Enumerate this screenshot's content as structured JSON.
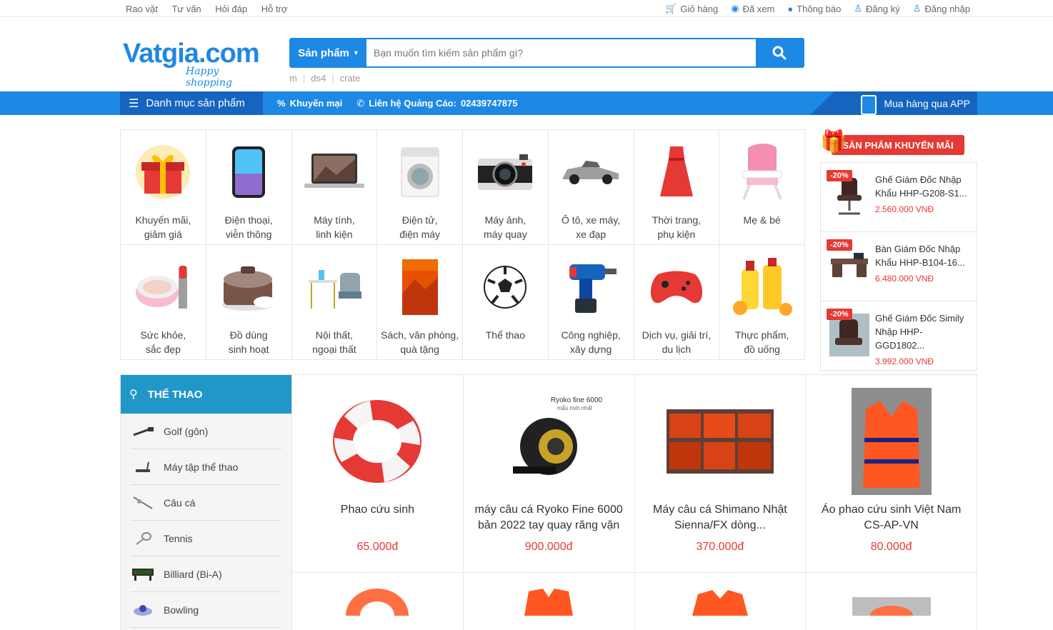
{
  "topbar": {
    "left": [
      "Rao vặt",
      "Tư vấn",
      "Hỏi đáp",
      "Hỗ trợ"
    ],
    "cart": "Giỏ hàng",
    "viewed": "Đã xem",
    "notify": "Thông báo",
    "register": "Đăng ký",
    "login": "Đăng nhập"
  },
  "logo": {
    "main": "Vatgia.com",
    "sub": "Happy shopping"
  },
  "search": {
    "category": "Sản phẩm",
    "placeholder": "Bạn muốn tìm kiếm sản phẩm gì?"
  },
  "keywords": [
    "m",
    "ds4",
    "crate"
  ],
  "nav": {
    "categories": "Danh mục sản phẩm",
    "promo": "Khuyến mại",
    "ads_label": "Liên hệ Quảng Cáo:",
    "ads_phone": "02439747875",
    "app": "Mua hàng qua APP"
  },
  "categories": [
    {
      "l1": "Khuyến mãi,",
      "l2": "giảm giá",
      "icon": "gift-icon"
    },
    {
      "l1": "Điện thoại,",
      "l2": "viễn thông",
      "icon": "phone-icon"
    },
    {
      "l1": "Máy tính,",
      "l2": "linh kiện",
      "icon": "laptop-icon"
    },
    {
      "l1": "Điện tử,",
      "l2": "điện máy",
      "icon": "washer-icon"
    },
    {
      "l1": "Máy ảnh,",
      "l2": "máy quay",
      "icon": "camera-icon"
    },
    {
      "l1": "Ô tô, xe máy,",
      "l2": "xe đạp",
      "icon": "car-icon"
    },
    {
      "l1": "Thời trang,",
      "l2": "phụ kiện",
      "icon": "dress-icon"
    },
    {
      "l1": "Mẹ & bé",
      "l2": "",
      "icon": "baby-chair-icon"
    },
    {
      "l1": "Sức khỏe,",
      "l2": "sắc đẹp",
      "icon": "cosmetic-icon"
    },
    {
      "l1": "Đồ dùng",
      "l2": "sinh hoạt",
      "icon": "rice-cooker-icon"
    },
    {
      "l1": "Nội thất,",
      "l2": "ngoại thất",
      "icon": "furniture-icon"
    },
    {
      "l1": "Sách, văn phòng,",
      "l2": "quà tặng",
      "icon": "book-icon"
    },
    {
      "l1": "Thể thao",
      "l2": "",
      "icon": "football-icon"
    },
    {
      "l1": "Công nghiệp,",
      "l2": "xây dựng",
      "icon": "drill-icon"
    },
    {
      "l1": "Dịch vụ, giải trí,",
      "l2": "du lịch",
      "icon": "gamepad-icon"
    },
    {
      "l1": "Thực phẩm,",
      "l2": "đồ uống",
      "icon": "juice-icon"
    }
  ],
  "promo": {
    "title": "SẢN PHẨM KHUYẾN MÃI",
    "items": [
      {
        "badge": "-20%",
        "name": "Ghế Giám Đốc Nhập Khẩu HHP-G208-S1...",
        "price": "2.560.000 VNĐ"
      },
      {
        "badge": "-20%",
        "name": "Bàn Giám Đốc Nhập Khẩu HHP-B104-16...",
        "price": "6.480.000 VNĐ"
      },
      {
        "badge": "-20%",
        "name": "Ghế Giám Đốc Simily Nhập HHP-GGD1802...",
        "price": "3.992.000 VNĐ"
      }
    ]
  },
  "sport": {
    "title": "THỂ THAO",
    "menu": [
      "Golf (gôn)",
      "Máy tập thể thao",
      "Câu cá",
      "Tennis",
      "Billiard (Bi-A)",
      "Bowling"
    ],
    "products": [
      {
        "name": "Phao cứu sinh",
        "price": "65.000đ"
      },
      {
        "name": "máy câu cá Ryoko Fine 6000 bản 2022 tay quay răng vặn",
        "price": "900.000đ"
      },
      {
        "name": "Máy câu cá Shimano Nhật Sienna/FX dòng...",
        "price": "370.000đ"
      },
      {
        "name": "Áo phao cứu sinh Việt Nam CS-AP-VN",
        "price": "80.000đ"
      }
    ],
    "reel_brand": "Ryoko fine 6000",
    "reel_sub": "mẫu mới nhất"
  }
}
